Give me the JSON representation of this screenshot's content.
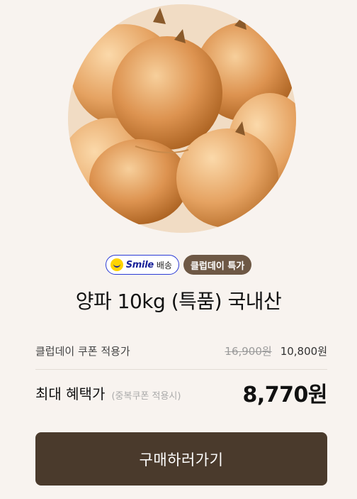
{
  "product": {
    "image_alt": "onions",
    "badges": {
      "smile_word": "Smile",
      "smile_ship": "배송",
      "club": "클럽데이 특가"
    },
    "title": "양파 10kg (특품) 국내산"
  },
  "pricing": {
    "coupon_label": "클럽데이 쿠폰 적용가",
    "original_price": "16,900원",
    "coupon_price": "10,800원",
    "max_label": "최대 혜택가",
    "max_note": "(중복쿠폰 적용시)",
    "max_price": "8,770원"
  },
  "cta": {
    "label": "구매하러가기"
  },
  "colors": {
    "background": "#f8f3ef",
    "button": "#4a3a2c",
    "club_badge": "#6e5845",
    "smile_border": "#2b3bd6"
  }
}
